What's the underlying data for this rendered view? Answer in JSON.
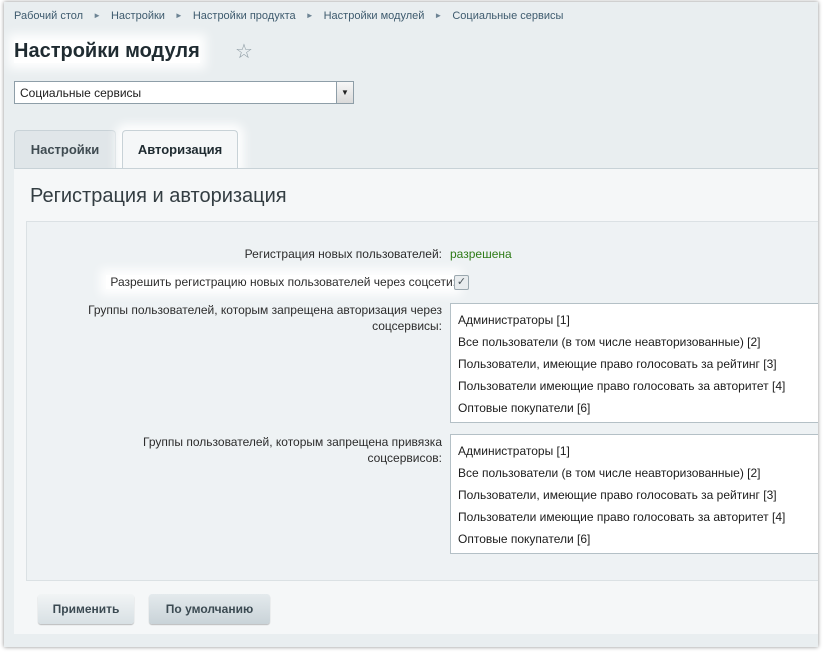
{
  "breadcrumb": [
    "Рабочий стол",
    "Настройки",
    "Настройки продукта",
    "Настройки модулей",
    "Социальные сервисы"
  ],
  "page_title": "Настройки модуля",
  "module_select": {
    "value": "Социальные сервисы"
  },
  "tabs": [
    {
      "label": "Настройки",
      "active": false
    },
    {
      "label": "Авторизация",
      "active": true
    }
  ],
  "section_title": "Регистрация и авторизация",
  "registration": {
    "label": "Регистрация новых пользователей:",
    "value": "разрешена",
    "value_color": "#2e7b17"
  },
  "allow_social_reg": {
    "label": "Разрешить регистрацию новых пользователей через соцсети:",
    "checked": true
  },
  "auth_groups": {
    "label_line1": "Группы пользователей, которым запрещена авторизация через",
    "label_line2": "соцсервисы:",
    "options": [
      "Администраторы [1]",
      "Все пользователи (в том числе неавторизованные) [2]",
      "Пользователи, имеющие право голосовать за рейтинг [3]",
      "Пользователи имеющие право голосовать за авторитет [4]",
      "Оптовые покупатели [6]"
    ]
  },
  "bind_groups": {
    "label_line1": "Группы пользователей, которым запрещена привязка",
    "label_line2": "соцсервисов:",
    "options": [
      "Администраторы [1]",
      "Все пользователи (в том числе неавторизованные) [2]",
      "Пользователи, имеющие право голосовать за рейтинг [3]",
      "Пользователи имеющие право голосовать за авторитет [4]",
      "Оптовые покупатели [6]"
    ]
  },
  "buttons": {
    "apply": "Применить",
    "default": "По умолчанию"
  },
  "colors": {
    "background": "#e9eef0",
    "accent_green": "#2e7b17"
  }
}
